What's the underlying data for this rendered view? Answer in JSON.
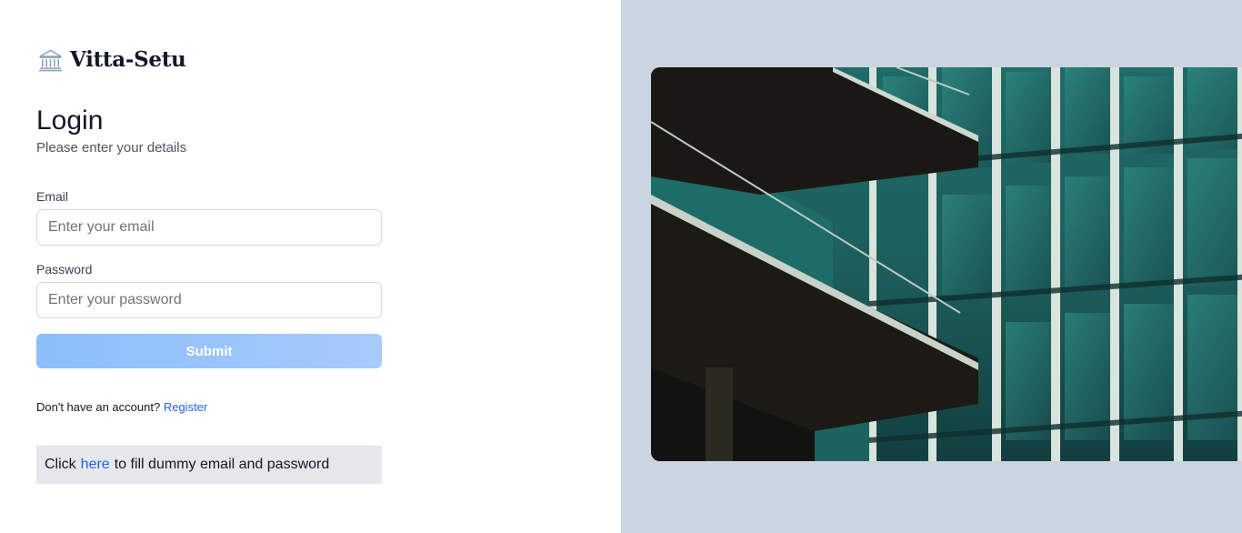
{
  "brand": {
    "name": "Vitta-Setu",
    "icon": "bank-building-icon"
  },
  "login": {
    "title": "Login",
    "subtitle": "Please enter your details"
  },
  "form": {
    "email_label": "Email",
    "email_placeholder": "Enter your email",
    "email_value": "",
    "password_label": "Password",
    "password_placeholder": "Enter your password",
    "password_value": "",
    "submit_label": "Submit"
  },
  "register": {
    "prompt": "Don't have an account?",
    "link_label": "Register"
  },
  "dummy_fill": {
    "prefix": "Click",
    "link_label": "here",
    "suffix": "to fill dummy email and password"
  },
  "colors": {
    "accent": "#2563eb",
    "submit_gradient_start": "#8bbefb",
    "submit_gradient_end": "#a7cafa",
    "right_panel_bg": "#cbd5e1",
    "dummy_box_bg": "#e5e7eb"
  },
  "hero_image": {
    "subject": "glass office building facade with balconies"
  }
}
